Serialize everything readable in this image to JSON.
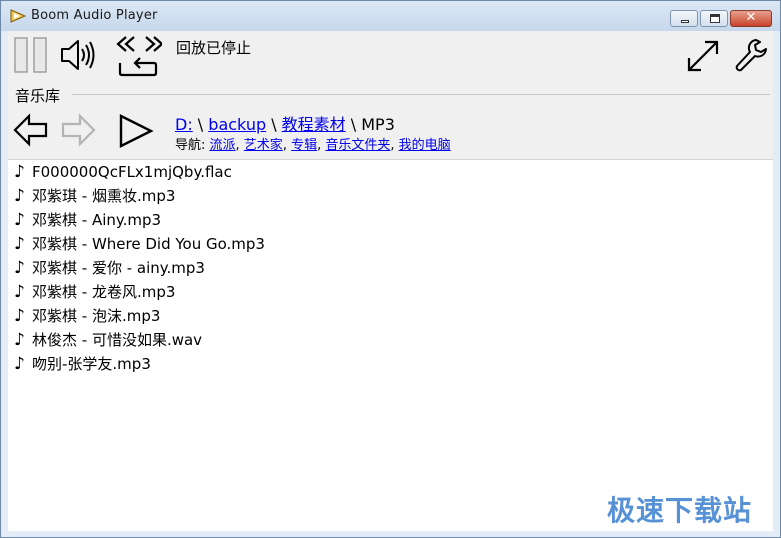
{
  "window": {
    "title": "Boom Audio Player",
    "close_glyph": "✕"
  },
  "toolbar": {
    "status": "回放已停止"
  },
  "library": {
    "label": "音乐库",
    "path": {
      "drive": "D:",
      "sep1": " \\ ",
      "folder1": "backup",
      "sep2": " \\ ",
      "folder2": "教程素材",
      "sep3": " \\ ",
      "current": "MP3"
    },
    "nav": {
      "label": "导航: ",
      "links": [
        "流派",
        "艺术家",
        "专辑",
        "音乐文件夹",
        "我的电脑"
      ],
      "sep": ", "
    }
  },
  "files": [
    "F000000QcFLx1mjQby.flac",
    "邓紫琪 - 烟熏妆.mp3",
    "邓紫棋 - Ainy.mp3",
    "邓紫棋 - Where Did You Go.mp3",
    "邓紫棋 - 爱你 - ainy.mp3",
    "邓紫棋 - 龙卷风.mp3",
    "邓紫棋 - 泡沫.mp3",
    "林俊杰 - 可惜没如果.wav",
    "吻别-张学友.mp3"
  ],
  "note_glyph": "♪",
  "watermark": "极速下载站",
  "colors": {
    "link": "#0000ee",
    "close_button": "#c7432a",
    "watermark": "#3a7fcf"
  }
}
